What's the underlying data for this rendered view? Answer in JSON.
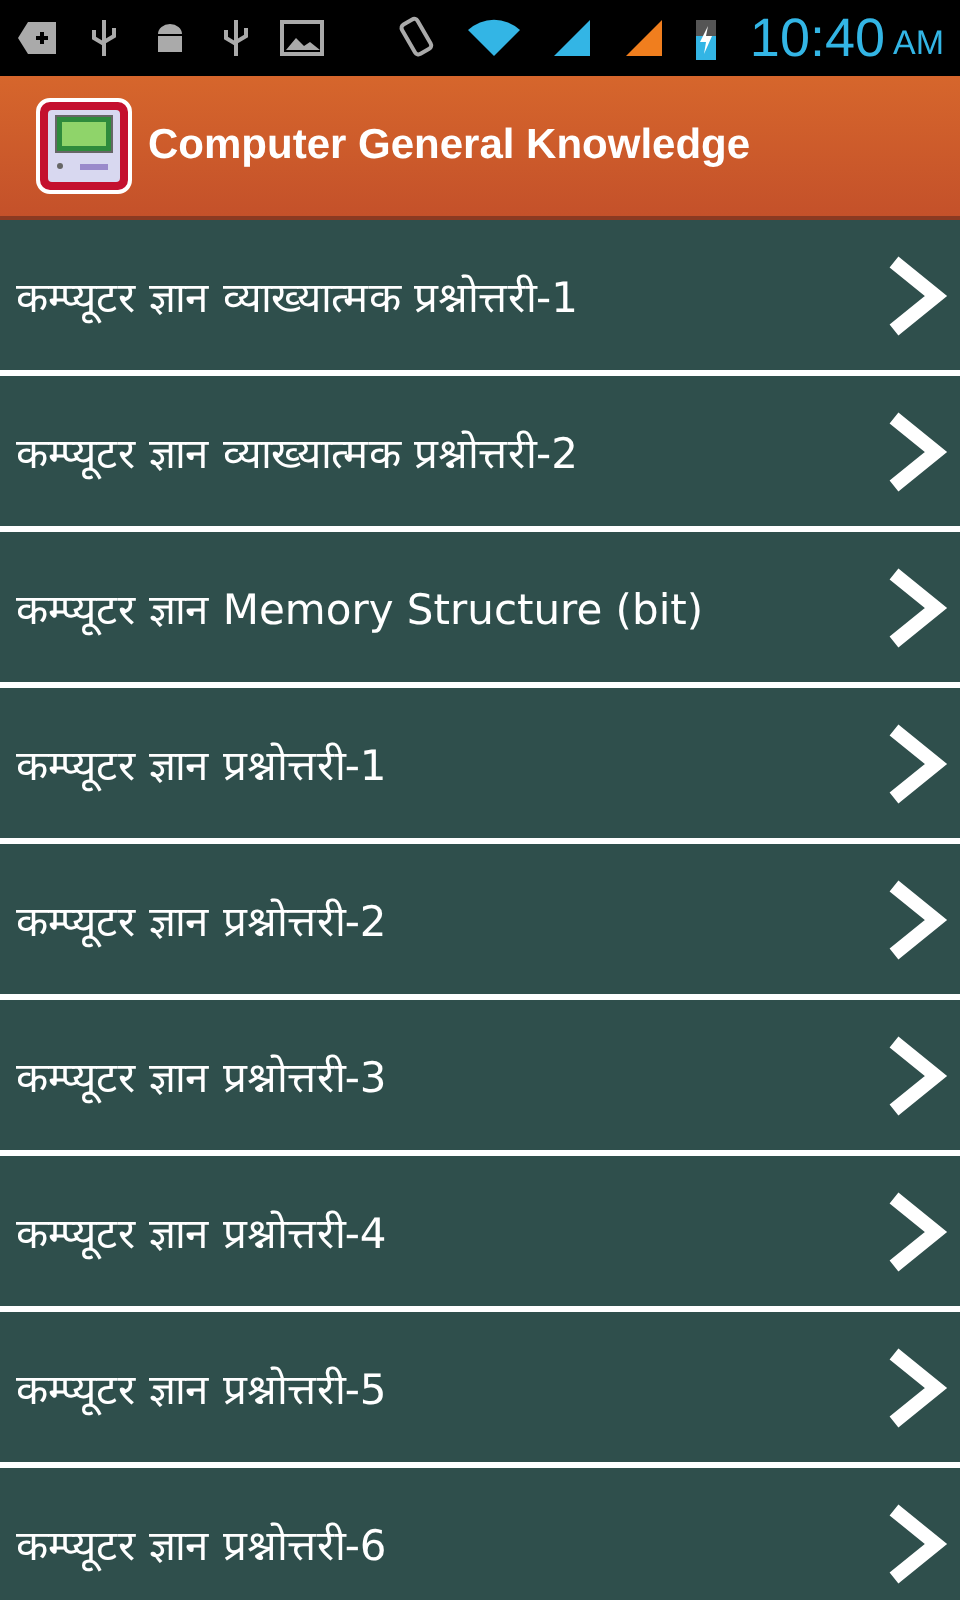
{
  "status_bar": {
    "time": "10:40",
    "meridiem": "AM"
  },
  "app_bar": {
    "title": "Computer General Knowledge"
  },
  "items": [
    {
      "label": "कम्प्यूटर ज्ञान व्याख्यात्मक प्रश्नोत्तरी-1"
    },
    {
      "label": "कम्प्यूटर ज्ञान व्याख्यात्मक प्रश्नोत्तरी-2"
    },
    {
      "label": "कम्प्यूटर ज्ञान Memory Structure (bit)"
    },
    {
      "label": "कम्प्यूटर ज्ञान प्रश्नोत्तरी-1"
    },
    {
      "label": "कम्प्यूटर ज्ञान प्रश्नोत्तरी-2"
    },
    {
      "label": "कम्प्यूटर ज्ञान प्रश्नोत्तरी-3"
    },
    {
      "label": "कम्प्यूटर ज्ञान प्रश्नोत्तरी-4"
    },
    {
      "label": "कम्प्यूटर ज्ञान प्रश्नोत्तरी-5"
    },
    {
      "label": "कम्प्यूटर ज्ञान प्रश्नोत्तरी-6"
    }
  ]
}
